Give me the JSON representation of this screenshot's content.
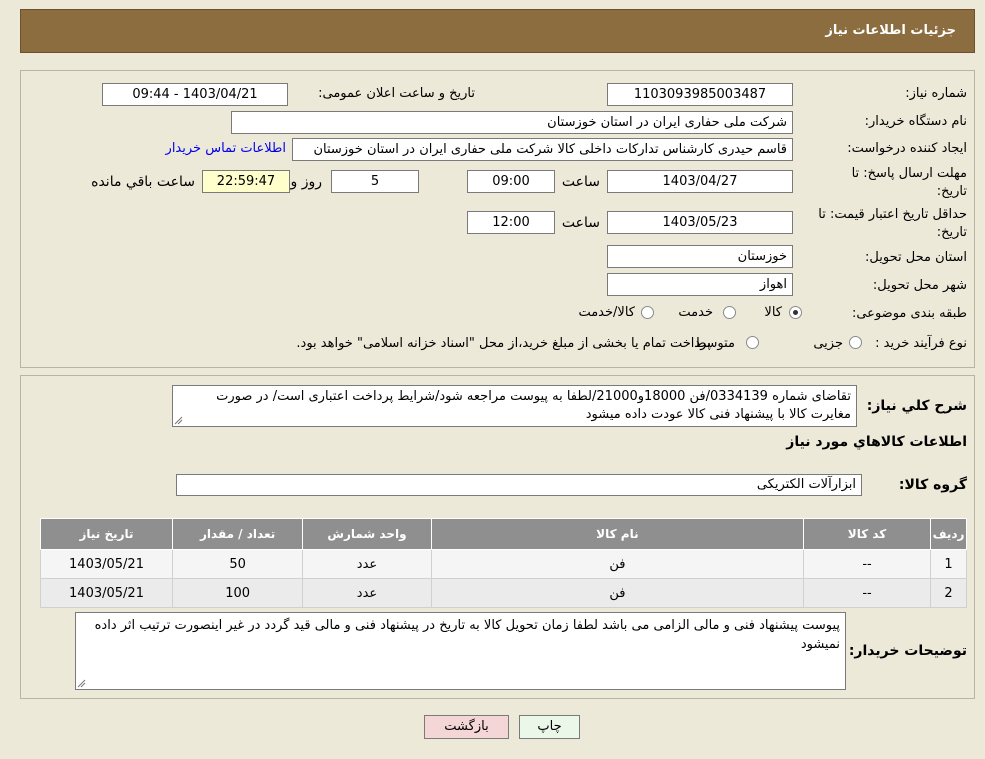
{
  "header": {
    "title": "جزئیات اطلاعات نیاز"
  },
  "form": {
    "need_number_label": "شماره نیاز:",
    "need_number": "1103093985003487",
    "announce_label": "تاریخ و ساعت اعلان عمومی:",
    "announce_value": "1403/04/21 - 09:44",
    "buyer_org_label": "نام دستگاه خریدار:",
    "buyer_org": "شرکت ملی حفاری ایران در استان خوزستان",
    "creator_label": "ایجاد کننده درخواست:",
    "creator": "قاسم حیدری کارشناس تدارکات داخلی کالا شرکت ملی حفاری ایران در استان خوزستان",
    "contact_link": "اطلاعات تماس خریدار",
    "deadline_label_1": "مهلت ارسال پاسخ: تا",
    "deadline_label_2": "تاریخ:",
    "deadline_date": "1403/04/27",
    "time_label": "ساعت",
    "deadline_time": "09:00",
    "days_value": "5",
    "days_label": "روز و",
    "remaining_time": "22:59:47",
    "remaining_label": "ساعت باقي مانده",
    "validity_label_1": "حداقل تاریخ اعتبار قیمت: تا",
    "validity_label_2": "تاریخ:",
    "validity_date": "1403/05/23",
    "validity_time": "12:00",
    "province_label": "استان محل تحویل:",
    "province": "خوزستان",
    "city_label": "شهر محل تحویل:",
    "city": "اهواز",
    "category_label": "طبقه بندی موضوعی:",
    "category_options": [
      "کالا",
      "خدمت",
      "کالا/خدمت"
    ],
    "category_selected": 0,
    "process_label": "نوع فرآیند خرید :",
    "process_options": [
      "جزیی",
      "متوسط"
    ],
    "process_note": "پرداخت تمام یا بخشی از مبلغ خرید،از محل \"اسناد خزانه اسلامی\" خواهد بود."
  },
  "description": {
    "label": "شرح کلي نياز:",
    "text": "تقاضای شماره 0334139/فن 18000و21000/لطفا به پیوست مراجعه شود/شرایط پرداخت اعتباری است/ در صورت مغایرت کالا با پیشنهاد فنی کالا عودت داده میشود"
  },
  "goods": {
    "title": "اطلاعات كالاهاي مورد نياز",
    "group_label": "گروه کالا:",
    "group_value": "ابزارآلات الکتریکی",
    "columns": [
      "رديف",
      "كد كالا",
      "نام كالا",
      "واحد شمارش",
      "تعداد / مقدار",
      "تاريخ نياز"
    ],
    "rows": [
      [
        "1",
        "--",
        "فن",
        "عدد",
        "50",
        "1403/05/21"
      ],
      [
        "2",
        "--",
        "فن",
        "عدد",
        "100",
        "1403/05/21"
      ]
    ]
  },
  "buyer_notes": {
    "label": "توضیحات خریدار:",
    "text": "پیوست پیشنهاد فنی و مالی الزامی می باشد لطفا زمان تحویل کالا به تاریخ در پیشنهاد فنی و مالی قید گردد در غیر اینصورت ترتیب اثر داده نمیشود"
  },
  "buttons": {
    "print": "چاپ",
    "back": "بازگشت"
  },
  "colors": {
    "header_bg": "#8b6d3f",
    "link": "#0000ee",
    "back_button_bg": "#f5d6d6",
    "print_button_bg": "#ebf7e8"
  }
}
